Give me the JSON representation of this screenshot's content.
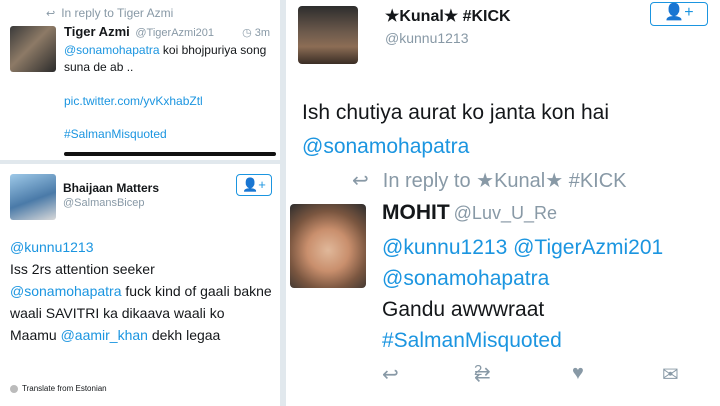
{
  "panel1": {
    "reply_icon": "reply-arrow-icon",
    "reply_text": "In reply to Tiger Azmi",
    "name": "Tiger Azmi",
    "handle": "@TigerAzmi201",
    "time": "3m",
    "mention": "@sonamohapatra",
    "text": " koi bhojpuriya song suna de ab ..",
    "link": "pic.twitter.com/yvKxhabZtl",
    "hashtag": "#SalmanMisquoted"
  },
  "panel2": {
    "name": "Bhaijaan Matters",
    "handle": "@SalmansBicep",
    "follow_icon": "follow-user-icon",
    "mention1": "@kunnu1213",
    "text1": "Iss 2rs attention seeker",
    "mention2": "@sonamohapatra",
    "text2": " fuck kind of gaali bakne waali SAVITRI ka dikaava waali ko",
    "text3": "Maamu ",
    "mention3": "@aamir_khan",
    "text4": " dekh legaa",
    "translate": "Translate from Estonian"
  },
  "panel3": {
    "name": "★Kunal★ #KICK",
    "handle": "@kunnu1213",
    "follow_icon": "follow-user-icon",
    "tweet_text": "Ish chutiya aurat ko janta kon hai",
    "tweet_mention": "@sonamohapatra",
    "reply_text": "In reply to ★Kunal★ #KICK",
    "reply_name": "MOHIT",
    "reply_handle": "@Luv_U_Re",
    "reply_mentions1": "@kunnu1213 @TigerAzmi201",
    "reply_mentions2": "@sonamohapatra",
    "reply_line": "Gandu awwwraat",
    "reply_hashtag": "#SalmanMisquoted",
    "retweet_count": "2"
  },
  "colors": {
    "link": "#1b95e0",
    "muted": "#8899a6",
    "text": "#14171a"
  }
}
